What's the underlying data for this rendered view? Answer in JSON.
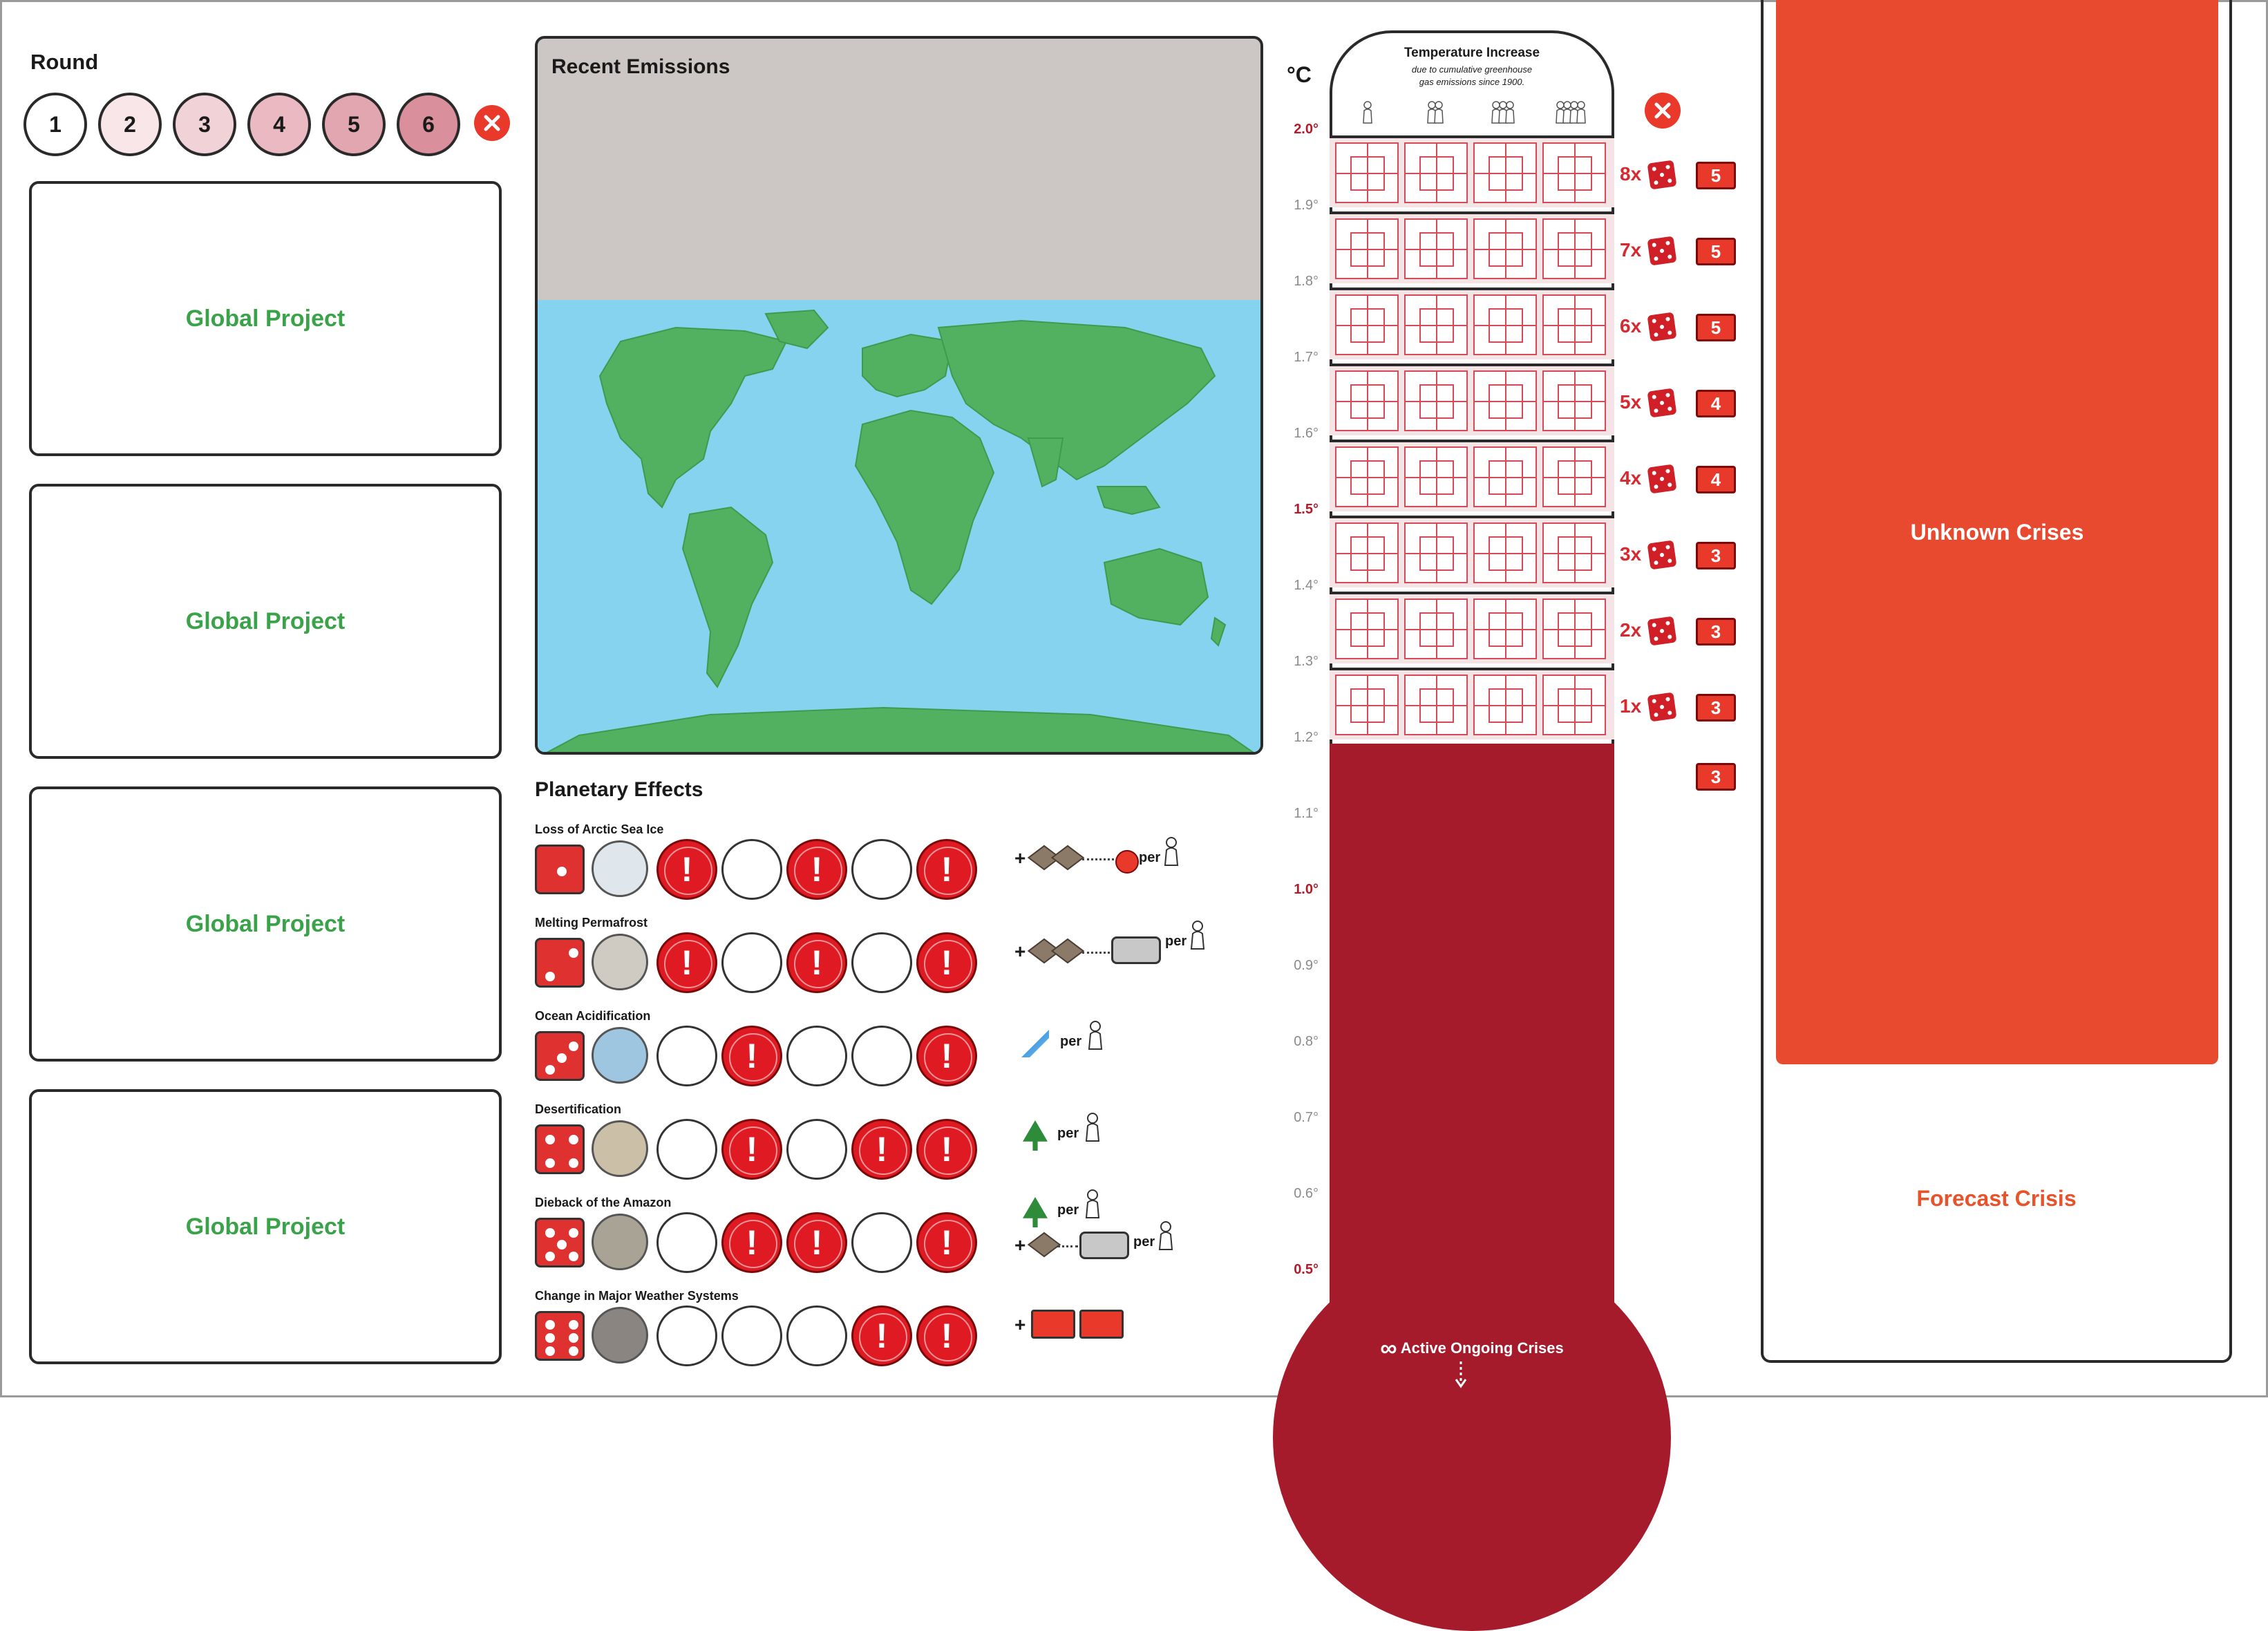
{
  "round": {
    "label": "Round",
    "numbers": [
      "1",
      "2",
      "3",
      "4",
      "5",
      "6"
    ],
    "fill_colors": [
      "#ffffff",
      "#f8e6e8",
      "#f1d2d7",
      "#eab9c1",
      "#e2a6b0",
      "#d98f9c"
    ]
  },
  "global_projects": [
    "Global Project",
    "Global Project",
    "Global Project",
    "Global Project"
  ],
  "map": {
    "title": "Recent Emissions"
  },
  "planetary_effects": {
    "title": "Planetary Effects",
    "rows": [
      {
        "name": "Loss of Arctic Sea Ice",
        "die": 1,
        "slots": [
          "alert",
          "empty",
          "alert",
          "empty",
          "alert-last"
        ],
        "effect_text": "per"
      },
      {
        "name": "Melting Permafrost",
        "die": 2,
        "slots": [
          "alert",
          "empty",
          "alert",
          "empty",
          "alert-last"
        ],
        "effect_text": "per"
      },
      {
        "name": "Ocean Acidification",
        "die": 3,
        "slots": [
          "empty",
          "alert",
          "empty",
          "empty",
          "alert-last"
        ],
        "effect_text": "per"
      },
      {
        "name": "Desertification",
        "die": 4,
        "slots": [
          "empty",
          "alert",
          "empty",
          "alert",
          "alert-last"
        ],
        "effect_text": "per"
      },
      {
        "name": "Dieback of the Amazon",
        "die": 5,
        "slots": [
          "empty",
          "alert",
          "alert",
          "empty",
          "alert-last"
        ],
        "effect_text": "per"
      },
      {
        "name": "Change in Major Weather Systems",
        "die": 6,
        "slots": [
          "empty",
          "empty",
          "empty",
          "alert",
          "alert-last"
        ],
        "effect_text": ""
      }
    ],
    "plus": "+",
    "alert_mark": "!"
  },
  "thermometer": {
    "title": "Temperature Increase",
    "subtitle_line1": "due to cumulative greenhouse",
    "subtitle_line2": "gas emissions since 1900.",
    "unit": "°C",
    "ticks": [
      {
        "label": "2.0°",
        "highlight": true
      },
      {
        "label": "1.9°",
        "highlight": false
      },
      {
        "label": "1.8°",
        "highlight": false
      },
      {
        "label": "1.7°",
        "highlight": false
      },
      {
        "label": "1.6°",
        "highlight": false
      },
      {
        "label": "1.5°",
        "highlight": true
      },
      {
        "label": "1.4°",
        "highlight": false
      },
      {
        "label": "1.3°",
        "highlight": false
      },
      {
        "label": "1.2°",
        "highlight": false
      },
      {
        "label": "1.1°",
        "highlight": false
      },
      {
        "label": "1.0°",
        "highlight": true
      },
      {
        "label": "0.9°",
        "highlight": false
      },
      {
        "label": "0.8°",
        "highlight": false
      },
      {
        "label": "0.7°",
        "highlight": false
      },
      {
        "label": "0.6°",
        "highlight": false
      },
      {
        "label": "0.5°",
        "highlight": true
      }
    ],
    "dice_rows": [
      {
        "mult": "8x",
        "count": "5"
      },
      {
        "mult": "7x",
        "count": "5"
      },
      {
        "mult": "6x",
        "count": "5"
      },
      {
        "mult": "5x",
        "count": "4"
      },
      {
        "mult": "4x",
        "count": "4"
      },
      {
        "mult": "3x",
        "count": "3"
      },
      {
        "mult": "2x",
        "count": "3"
      },
      {
        "mult": "1x",
        "count": "3"
      }
    ],
    "extra_count": "3",
    "active_label": "Active Ongoing Crises",
    "infinity_glyph": "∞",
    "fill_color": "#a51b2b"
  },
  "crises": {
    "unknown_label": "Unknown Crises",
    "forecast_label": "Forecast Crisis",
    "unknown_color": "#e84a30"
  },
  "icons": [
    "close-icon",
    "die-icon",
    "meeple-icon",
    "cube-icon",
    "infinity-icon",
    "thermometer-icon"
  ]
}
